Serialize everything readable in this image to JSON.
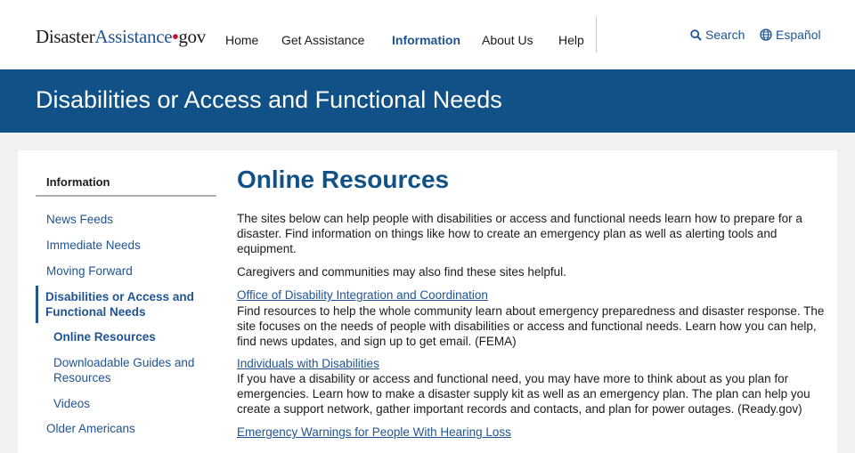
{
  "header": {
    "logo": {
      "part1": "Disaster",
      "part2": "Assistance",
      "dot": "•",
      "part3": "gov"
    },
    "nav": [
      {
        "label": "Home"
      },
      {
        "label": "Get Assistance"
      },
      {
        "label": "Information",
        "active": true
      },
      {
        "label": "About Us"
      },
      {
        "label": "Help"
      }
    ],
    "search_label": "Search",
    "language_label": "Español",
    "search_icon": "search-icon",
    "language_icon": "globe-icon"
  },
  "banner": {
    "title": "Disabilities or Access and Functional Needs"
  },
  "sidebar": {
    "title": "Information",
    "items": [
      {
        "label": "News Feeds"
      },
      {
        "label": "Immediate Needs"
      },
      {
        "label": "Moving Forward"
      },
      {
        "label_line1": "Disabilities or Access and",
        "label_line2": "Functional Needs",
        "current": true
      },
      {
        "label": "Online Resources",
        "current": true
      },
      {
        "label_line1": "Downloadable Guides and",
        "label_line2": "Resources"
      },
      {
        "label": "Videos"
      },
      {
        "label": "Older Americans"
      }
    ]
  },
  "main": {
    "title": "Online Resources",
    "intro": "The sites below can help people with disabilities or access and functional needs learn how to prepare for a disaster. Find information on things like how to create an emergency plan as well as alerting tools and equipment.",
    "caregivers": "Caregivers and communities may also find these sites helpful.",
    "resources": [
      {
        "link": "Office of Disability Integration and Coordination",
        "description": "Find resources to help the whole community learn about emergency preparedness and disaster response. The site focuses on the needs of people with disabilities or access and functional needs. Learn how you can help, find news updates, and sign up to get email. (FEMA)"
      },
      {
        "link": "Individuals with Disabilities",
        "description": "If you have a disability or access and functional need, you may have more to think about as you plan for emergencies. Learn how to make a disaster supply kit as well as an emergency plan. The plan can help you create a support network, gather important records and contacts, and plan for power outages. (Ready.gov)"
      },
      {
        "link": "Emergency Warnings for People With Hearing Loss"
      }
    ]
  },
  "colors": {
    "primary": "#105187",
    "link": "#205493",
    "accent_red": "#c41230"
  }
}
